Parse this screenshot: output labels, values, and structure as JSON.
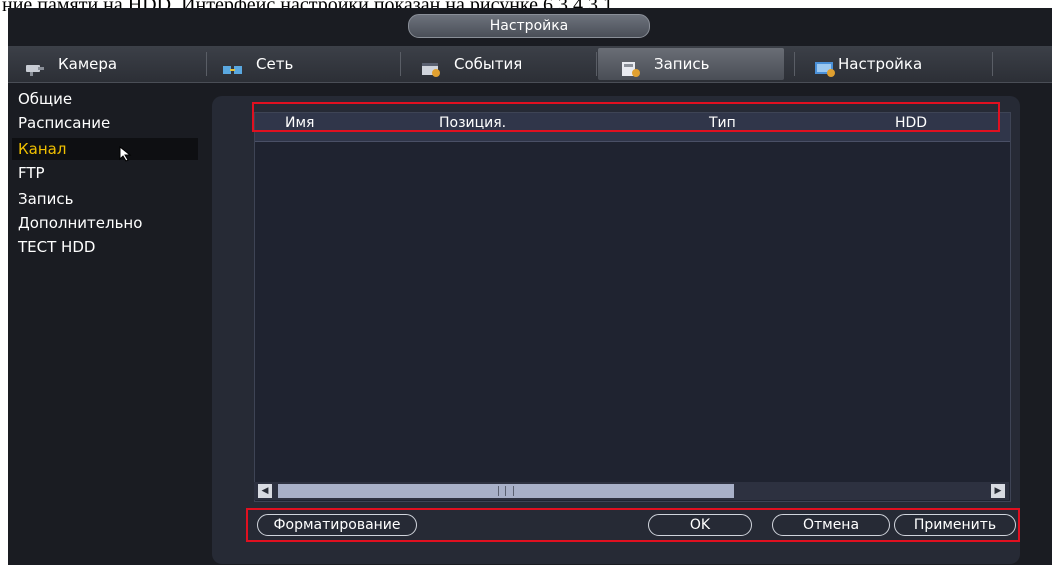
{
  "caption": "ние памяти на HDD. Интерфейс настройки показан на рисунке 6.3.4.3.1",
  "window": {
    "title": "Настройка"
  },
  "tabs": [
    {
      "label": "Камера",
      "icon": "camera-icon",
      "active": false
    },
    {
      "label": "Сеть",
      "icon": "network-icon",
      "active": false
    },
    {
      "label": "События",
      "icon": "events-icon",
      "active": false
    },
    {
      "label": "Запись",
      "icon": "record-icon",
      "active": true
    },
    {
      "label": "Настройка",
      "icon": "settings-icon",
      "active": false
    }
  ],
  "sidebar": {
    "items": [
      {
        "label": "Общие"
      },
      {
        "label": "Расписание"
      },
      {
        "label": "Канал",
        "active": true
      },
      {
        "label": "FTP"
      },
      {
        "label": "Запись"
      },
      {
        "label": "Дополнительно"
      },
      {
        "label": "ТЕСТ HDD"
      }
    ]
  },
  "table": {
    "columns": [
      "Имя",
      "Позиция.",
      "Тип",
      "HDD"
    ],
    "rows": []
  },
  "buttons": {
    "format": "Форматирование",
    "ok": "OK",
    "cancel": "Отмена",
    "apply": "Применить"
  },
  "colors": {
    "highlight": "#e01020",
    "active_text": "#f0c000"
  }
}
